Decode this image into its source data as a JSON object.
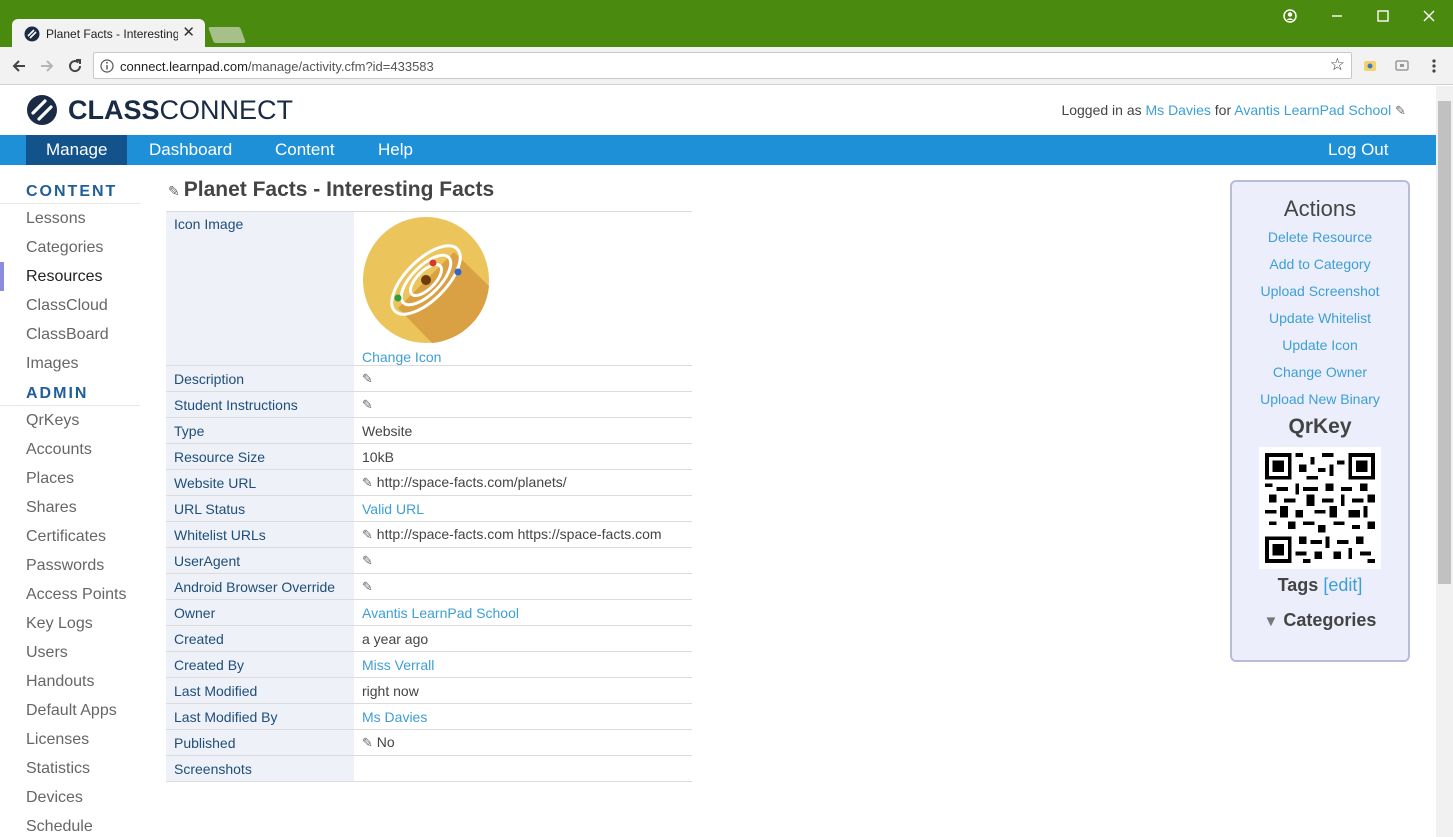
{
  "browser": {
    "tab_title": "Planet Facts - Interesting Facts",
    "url_host": "connect.learnpad.com",
    "url_path": "/manage/activity.cfm?id=433583",
    "colors": {
      "titlebar": "#4a8a0e",
      "toolbar": "#f2f2f2"
    }
  },
  "header": {
    "logo_bold": "CLASS",
    "logo_light": "CONNECT",
    "logged_prefix": "Logged in as",
    "user": "Ms Davies",
    "for_word": "for",
    "school": "Avantis LearnPad School"
  },
  "nav": {
    "items": [
      "Manage",
      "Dashboard",
      "Content",
      "Help"
    ],
    "logout": "Log Out",
    "colors": {
      "bar": "#1e90d8",
      "active": "#12538c"
    }
  },
  "sidebar": {
    "content_heading": "CONTENT",
    "content_items": [
      "Lessons",
      "Categories",
      "Resources",
      "ClassCloud",
      "ClassBoard",
      "Images"
    ],
    "admin_heading": "ADMIN",
    "admin_items": [
      "QrKeys",
      "Accounts",
      "Places",
      "Shares",
      "Certificates",
      "Passwords",
      "Access Points",
      "Key Logs",
      "Users",
      "Handouts",
      "Default Apps",
      "Licenses",
      "Statistics",
      "Devices",
      "Schedule"
    ]
  },
  "main": {
    "title": "Planet Facts - Interesting Facts",
    "icon_label": "Icon Image",
    "change_icon": "Change Icon",
    "rows": {
      "description": {
        "k": "Description"
      },
      "instructions": {
        "k": "Student Instructions"
      },
      "type": {
        "k": "Type",
        "v": "Website"
      },
      "size": {
        "k": "Resource Size",
        "v": "10kB"
      },
      "website": {
        "k": "Website URL",
        "v": "http://space-facts.com/planets/"
      },
      "status": {
        "k": "URL Status",
        "v": "Valid URL"
      },
      "whitelist": {
        "k": "Whitelist URLs",
        "v": "http://space-facts.com https://space-facts.com"
      },
      "useragent": {
        "k": "UserAgent"
      },
      "android": {
        "k": "Android Browser Override"
      },
      "owner": {
        "k": "Owner",
        "v": "Avantis LearnPad School"
      },
      "created": {
        "k": "Created",
        "v": "a year ago"
      },
      "created_by": {
        "k": "Created By",
        "v": "Miss Verrall"
      },
      "modified": {
        "k": "Last Modified",
        "v": "right now"
      },
      "modified_by": {
        "k": "Last Modified By",
        "v": "Ms Davies"
      },
      "published": {
        "k": "Published",
        "v": "No"
      },
      "screenshots": {
        "k": "Screenshots"
      }
    }
  },
  "actions": {
    "title": "Actions",
    "links": [
      "Delete Resource",
      "Add to Category",
      "Upload Screenshot",
      "Update Whitelist",
      "Update Icon",
      "Change Owner",
      "Upload New Binary"
    ],
    "qr_title": "QrKey",
    "tags_label": "Tags",
    "tags_edit": "[edit]",
    "categories": "Categories",
    "colors": {
      "panel_bg": "#eceefb",
      "border": "#b8bcdc",
      "link": "#3c9fd6"
    }
  }
}
